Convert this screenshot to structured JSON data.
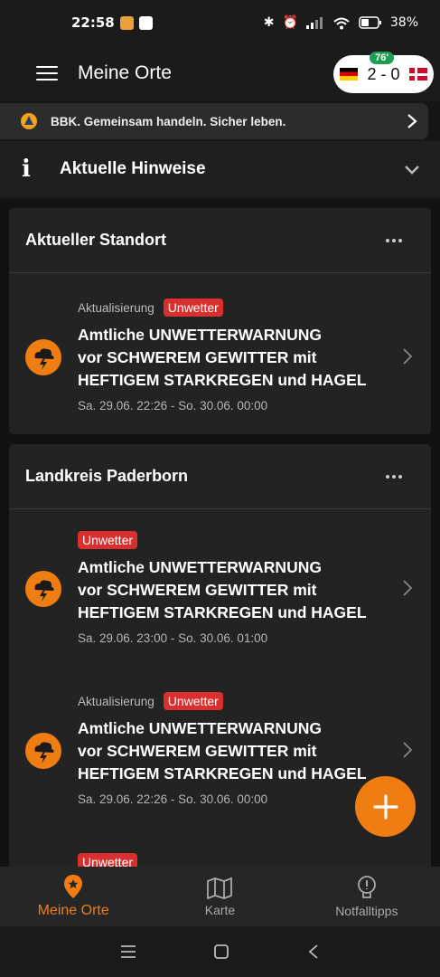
{
  "status": {
    "time": "22:58",
    "battery": "38%"
  },
  "appbar": {
    "title": "Meine Orte",
    "score": {
      "minute": "76'",
      "text": "2 - 0"
    }
  },
  "banner": {
    "text": "BBK. Gemeinsam handeln. Sicher leben."
  },
  "hints": {
    "label": "Aktuelle Hinweise"
  },
  "sections": [
    {
      "title": "Aktueller Standort",
      "warnings": [
        {
          "update_label": "Aktualisierung",
          "tag": "Unwetter",
          "title_lines": [
            "Amtliche UNWETTERWARNUNG",
            "vor SCHWEREM GEWITTER mit",
            "HEFTIGEM STARKREGEN und HAGEL"
          ],
          "time": "Sa. 29.06. 22:26 - So. 30.06. 00:00"
        }
      ]
    },
    {
      "title": "Landkreis Paderborn",
      "warnings": [
        {
          "update_label": "",
          "tag": "Unwetter",
          "title_lines": [
            "Amtliche UNWETTERWARNUNG",
            "vor SCHWEREM GEWITTER mit",
            "HEFTIGEM STARKREGEN und HAGEL"
          ],
          "time": "Sa. 29.06. 23:00 - So. 30.06. 01:00"
        },
        {
          "update_label": "Aktualisierung",
          "tag": "Unwetter",
          "title_lines": [
            "Amtliche UNWETTERWARNUNG",
            "vor SCHWEREM GEWITTER mit",
            "HEFTIGEM STARKREGEN und HAGEL"
          ],
          "time": "Sa. 29.06. 22:26 - So. 30.06. 00:00"
        },
        {
          "update_label": "",
          "tag": "Unwetter"
        }
      ]
    }
  ],
  "bottom_nav": [
    {
      "label": "Meine Orte",
      "icon": "location-pin-icon",
      "active": true
    },
    {
      "label": "Karte",
      "icon": "map-icon",
      "active": false
    },
    {
      "label": "Notfalltipps",
      "icon": "lightbulb-icon",
      "active": false
    }
  ],
  "colors": {
    "accent": "#f07d12",
    "alert_red": "#d9302f",
    "background": "#121212",
    "card": "#232323"
  }
}
